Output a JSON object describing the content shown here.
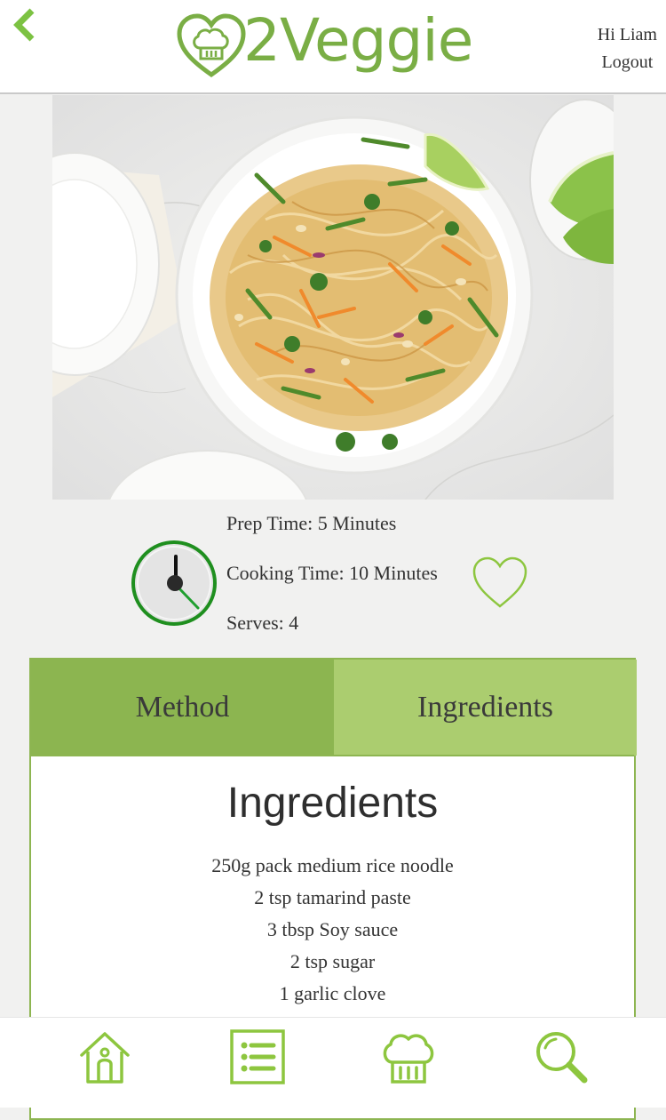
{
  "header": {
    "back_icon": "chevron-left-icon",
    "logo_icon": "heart-chef-hat-icon",
    "logo_text": "2Veggie",
    "greeting": "Hi Liam",
    "logout_label": "Logout"
  },
  "recipe": {
    "image": "pad-thai-noodles-photo",
    "prep_time": "Prep Time: 5 Minutes",
    "cooking_time": "Cooking Time: 10 Minutes",
    "serves": "Serves: 4",
    "clock_icon": "clock-icon",
    "favorite_icon": "heart-outline-icon"
  },
  "tabs": [
    {
      "label": "Method",
      "active": false
    },
    {
      "label": "Ingredients",
      "active": true
    }
  ],
  "ingredients": {
    "title": "Ingredients",
    "items": [
      "250g pack medium rice noodle",
      "2 tsp tamarind paste",
      "3 tbsp Soy sauce",
      "2 tsp sugar",
      "1 garlic clove"
    ]
  },
  "bottom_nav": [
    {
      "icon": "home-icon"
    },
    {
      "icon": "list-icon"
    },
    {
      "icon": "chef-hat-icon"
    },
    {
      "icon": "search-icon"
    }
  ],
  "colors": {
    "brand_green": "#7aae45",
    "tab_active": "#8cb550",
    "tab_inactive": "#abcd6f",
    "icon_green": "#8dc63f",
    "clock_ring": "#1f8f1f"
  }
}
